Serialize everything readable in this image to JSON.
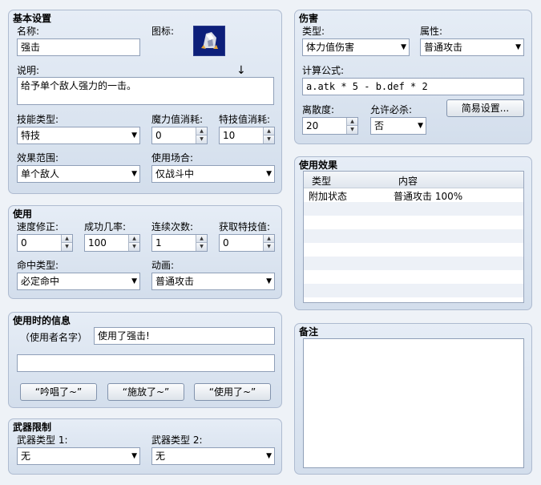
{
  "basic": {
    "title": "基本设置",
    "name_label": "名称:",
    "name_value": "强击",
    "icon_label": "图标:",
    "desc_label": "说明:",
    "desc_value": "给予单个敌人强力的一击。",
    "skill_type_label": "技能类型:",
    "skill_type_value": "特技",
    "mp_cost_label": "魔力值消耗:",
    "mp_cost_value": "0",
    "tp_cost_label": "特技值消耗:",
    "tp_cost_value": "10",
    "scope_label": "效果范围:",
    "scope_value": "单个敌人",
    "occasion_label": "使用场合:",
    "occasion_value": "仅战斗中"
  },
  "invocation": {
    "title": "使用",
    "speed_label": "速度修正:",
    "speed_value": "0",
    "success_label": "成功几率:",
    "success_value": "100",
    "repeat_label": "连续次数:",
    "repeat_value": "1",
    "tp_gain_label": "获取特技值:",
    "tp_gain_value": "0",
    "hit_type_label": "命中类型:",
    "hit_type_value": "必定命中",
    "animation_label": "动画:",
    "animation_value": "普通攻击"
  },
  "message": {
    "title": "使用时的信息",
    "user_name_label": "（使用者名字）",
    "line1_value": "使用了强击!",
    "line2_value": "",
    "btn_cast": "“吟唱了~”",
    "btn_perform": "“施放了~”",
    "btn_use": "“使用了~”"
  },
  "weapon": {
    "title": "武器限制",
    "type1_label": "武器类型 1:",
    "type1_value": "无",
    "type2_label": "武器类型 2:",
    "type2_value": "无"
  },
  "damage": {
    "title": "伤害",
    "type_label": "类型:",
    "type_value": "体力值伤害",
    "element_label": "属性:",
    "element_value": "普通攻击",
    "formula_label": "计算公式:",
    "formula_value": "a.atk * 5 - b.def * 2",
    "variance_label": "离散度:",
    "variance_value": "20",
    "critical_label": "允许必杀:",
    "critical_value": "否",
    "easy_setup_label": "简易设置..."
  },
  "effects": {
    "title": "使用效果",
    "col_type": "类型",
    "col_content": "内容",
    "rows": [
      {
        "type": "附加状态",
        "content": "普通攻击  100%"
      }
    ]
  },
  "note": {
    "title": "备注",
    "value": ""
  },
  "misc": {
    "cursor_glyph": "↓"
  }
}
